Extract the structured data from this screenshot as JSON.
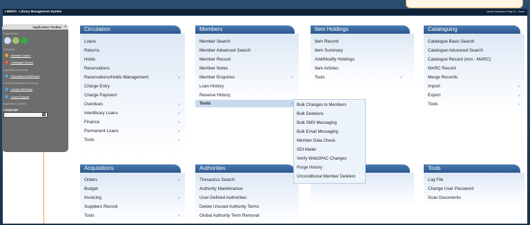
{
  "app": {
    "title": "LIBERO - Library Management System",
    "info": "Library Dashboard Page 01 - Home"
  },
  "toolbar": {
    "title": "Application Toolbar",
    "collapse_icon": "double-chevron-right-icon",
    "sections": {
      "page_actions": "Page Actions",
      "discovery": "Discovery",
      "application_shortcuts": "Application Shortcuts",
      "external_shortcuts": "External Application Shortcuts",
      "application_options": "Application Options"
    },
    "links": {
      "member_search": "Member Search",
      "catalogue_search": "Catalogue Search",
      "parameters_dashboard": "Parameters Dashboard",
      "library_webopac": "Library WebOpac",
      "libero_support": "Libero Support"
    },
    "language_label": "Language"
  },
  "circulation": {
    "title": "Circulation",
    "items": [
      "Loans",
      "Returns",
      "Holds",
      "Reservations",
      "Reservations/Holds Management",
      "Charge Entry",
      "Charge Payment",
      "Overdues",
      "Interlibrary Loans",
      "Finance",
      "Permanent Loans",
      "Tools"
    ]
  },
  "members": {
    "title": "Members",
    "items": [
      "Member Search",
      "Member Advanced Search",
      "Member Record",
      "Member Notes",
      "Member Enquiries",
      "Loan History",
      "Reserve History",
      "Tools"
    ]
  },
  "item_holdings": {
    "title": "Item Holdings",
    "items": [
      "Item Record",
      "Item Summary",
      "Add/Modify Holdings",
      "Item Articles",
      "Tools"
    ]
  },
  "cataloguing": {
    "title": "Cataloguing",
    "items": [
      "Catalogue Basic Search",
      "Catalogue Advanced Search",
      "Catalogue Record (non - MARC)",
      "MARC Record",
      "Merge Records",
      "Import",
      "Export",
      "Tools"
    ]
  },
  "acquisitions": {
    "title": "Acquisitions",
    "items": [
      "Orders",
      "Budget",
      "Invoicing",
      "Suppliers Record",
      "Tools"
    ]
  },
  "authorities": {
    "title": "Authorities",
    "items": [
      "Thesaurus Search",
      "Authority Maintenance",
      "User-Defined Authorities",
      "Delete Unused Authority Terms",
      "Global Authority Term Removal"
    ]
  },
  "tools_panel": {
    "title": "Tools",
    "items": [
      "Log File",
      "Change User Password",
      "Scan Documents"
    ]
  },
  "tools_dropdown": {
    "items": [
      "Bulk Changes to Members",
      "Bulk Deletions",
      "Bulk SMS Messaging",
      "Bulk Email Messaging",
      "Member Data Check",
      "SDI Mailer",
      "Verify WebOPAC Changes",
      "Purge History",
      "Unconditional Member Deletion"
    ]
  },
  "colors": {
    "panel_header": "#2b588e",
    "toolbar_bg": "#6d6d6d",
    "accent_orange": "#f2a34c"
  }
}
